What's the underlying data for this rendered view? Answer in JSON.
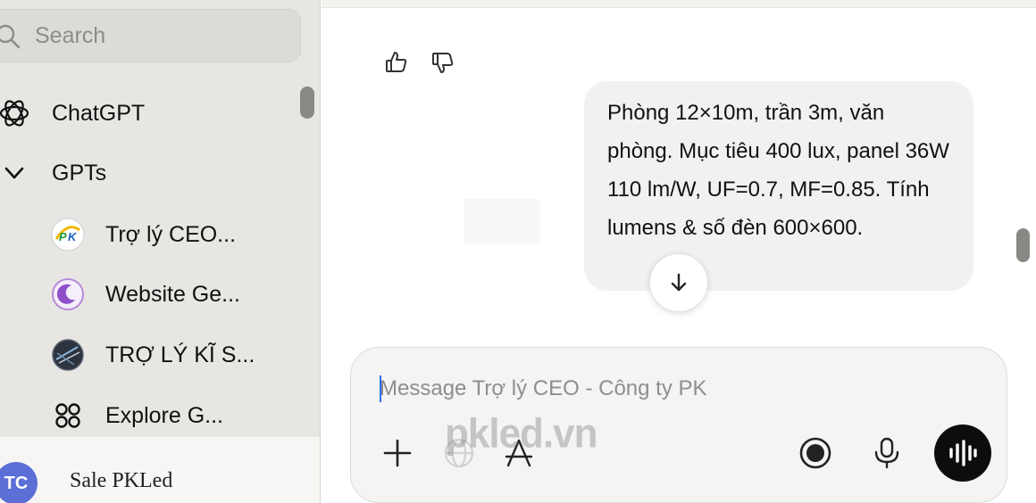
{
  "sidebar": {
    "search": {
      "placeholder": "Search"
    },
    "items": [
      {
        "label": "ChatGPT",
        "icon": "openai-logo-icon"
      },
      {
        "label": "GPTs",
        "icon": "chevron-down-icon"
      }
    ],
    "gpts": [
      {
        "label": "Trợ lý CEO...",
        "icon": "pk-logo-icon"
      },
      {
        "label": "Website Ge...",
        "icon": "crescent-logo-icon"
      },
      {
        "label": "TRỢ LÝ KĨ S...",
        "icon": "globe-avatar-icon"
      },
      {
        "label": "Explore G...",
        "icon": "grid-dots-icon"
      }
    ],
    "account": {
      "initials": "TC",
      "name": "Sale PKLed"
    }
  },
  "chat": {
    "user_message": "Phòng 12×10m, trần 3m, văn phòng. Mục tiêu 400 lux, panel 36W 110 lm/W, UF=0.7, MF=0.85. Tính lumens & số đèn 600×600.",
    "feedback": [
      "thumbs-up-icon",
      "thumbs-down-icon"
    ]
  },
  "composer": {
    "placeholder": "Message Trợ lý CEO - Công ty PK",
    "value": "",
    "buttons": [
      "plus-icon",
      "globe-icon",
      "tools-icon",
      "record-icon",
      "microphone-icon",
      "voice-mode-icon"
    ]
  },
  "watermark": "pkled.vn",
  "colors": {
    "sidebar_bg": "#e8e6e3",
    "bubble_bg": "#f1f1f0",
    "composer_bg": "#f4f4f3",
    "avatar_bg": "#5b6fd6",
    "caret": "#2f6fed"
  }
}
